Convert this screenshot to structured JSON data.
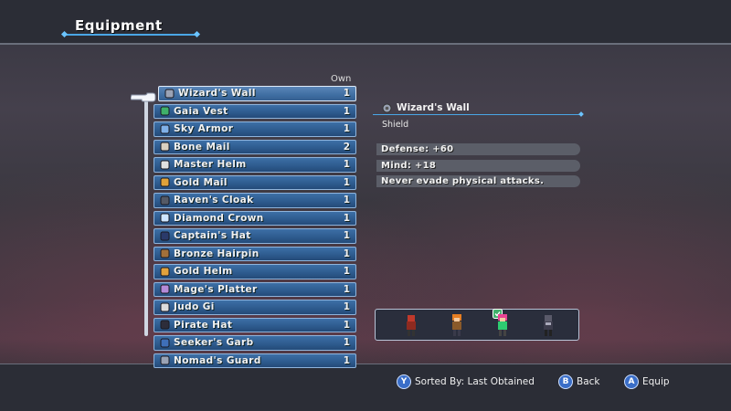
{
  "header": {
    "title": "Equipment"
  },
  "list": {
    "own_label": "Own",
    "items": [
      {
        "name": "Wizard's Wall",
        "count": "1",
        "icon": "shield-round-icon",
        "color": "#9aa3b5",
        "selected": true
      },
      {
        "name": "Gaia Vest",
        "count": "1",
        "icon": "vest-icon",
        "color": "#3fb06a"
      },
      {
        "name": "Sky Armor",
        "count": "1",
        "icon": "armor-icon",
        "color": "#7fb0e8"
      },
      {
        "name": "Bone Mail",
        "count": "2",
        "icon": "mail-icon",
        "color": "#d9d0c0"
      },
      {
        "name": "Master Helm",
        "count": "1",
        "icon": "helm-icon",
        "color": "#e0e0e0"
      },
      {
        "name": "Gold Mail",
        "count": "1",
        "icon": "mail-icon",
        "color": "#e0a23a"
      },
      {
        "name": "Raven's Cloak",
        "count": "1",
        "icon": "cloak-icon",
        "color": "#555a66"
      },
      {
        "name": "Diamond Crown",
        "count": "1",
        "icon": "crown-icon",
        "color": "#cfe6ff"
      },
      {
        "name": "Captain's Hat",
        "count": "1",
        "icon": "hat-icon",
        "color": "#2a3a6a"
      },
      {
        "name": "Bronze Hairpin",
        "count": "1",
        "icon": "hairpin-icon",
        "color": "#a3703a"
      },
      {
        "name": "Gold Helm",
        "count": "1",
        "icon": "helm-icon",
        "color": "#e2a23c"
      },
      {
        "name": "Mage's Platter",
        "count": "1",
        "icon": "platter-icon",
        "color": "#b48ad8"
      },
      {
        "name": "Judo Gi",
        "count": "1",
        "icon": "gi-icon",
        "color": "#dcdcdc"
      },
      {
        "name": "Pirate Hat",
        "count": "1",
        "icon": "hat-icon",
        "color": "#2d2d3a"
      },
      {
        "name": "Seeker's Garb",
        "count": "1",
        "icon": "garb-icon",
        "color": "#3f6fb8"
      },
      {
        "name": "Nomad's Guard",
        "count": "1",
        "icon": "guard-icon",
        "color": "#9aa3b5"
      }
    ]
  },
  "detail": {
    "name": "Wizard's Wall",
    "type": "Shield",
    "stats": [
      "Defense:  +60",
      "Mind:  +18",
      "Never evade physical attacks."
    ]
  },
  "party": {
    "members": [
      {
        "name": "red-armored-warrior",
        "color": "#c0392b"
      },
      {
        "name": "orange-haired-fighter",
        "color": "#e67e22"
      },
      {
        "name": "pink-haired-girl",
        "color": "#e84393"
      },
      {
        "name": "dark-armored-knight",
        "color": "#5a5a6a"
      }
    ],
    "equip_indicator_color": "#3fb06a"
  },
  "footer": {
    "sort_button": "Y",
    "sort_label": "Sorted By: Last Obtained",
    "back_button": "B",
    "back_label": "Back",
    "equip_button": "A",
    "equip_label": "Equip"
  }
}
